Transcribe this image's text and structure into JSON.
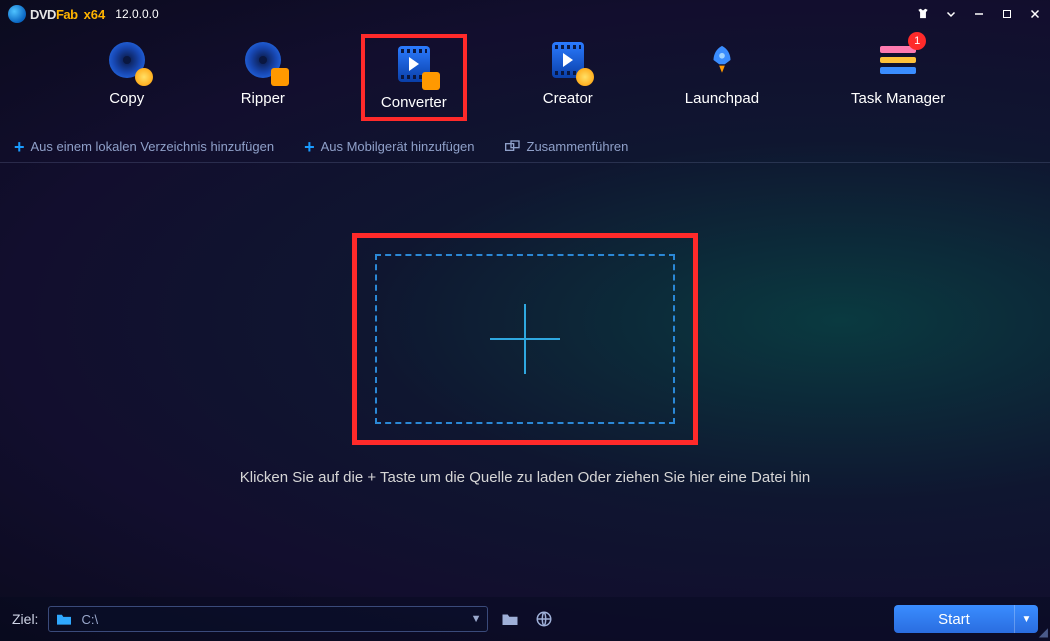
{
  "app": {
    "brand_dvd": "DVD",
    "brand_fab": "Fab",
    "arch": "x64",
    "version": "12.0.0.0"
  },
  "toolbar": {
    "copy": "Copy",
    "ripper": "Ripper",
    "converter": "Converter",
    "creator": "Creator",
    "launchpad": "Launchpad",
    "taskmgr": "Task Manager",
    "badge": "1"
  },
  "subbar": {
    "add_local": "Aus einem lokalen Verzeichnis hinzufügen",
    "add_mobile": "Aus Mobilgerät hinzufügen",
    "merge": "Zusammenführen"
  },
  "stage": {
    "hint": "Klicken Sie auf die + Taste um die Quelle zu laden Oder ziehen Sie hier eine Datei hin"
  },
  "footer": {
    "ziel_label": "Ziel:",
    "path": "C:\\",
    "start": "Start"
  }
}
